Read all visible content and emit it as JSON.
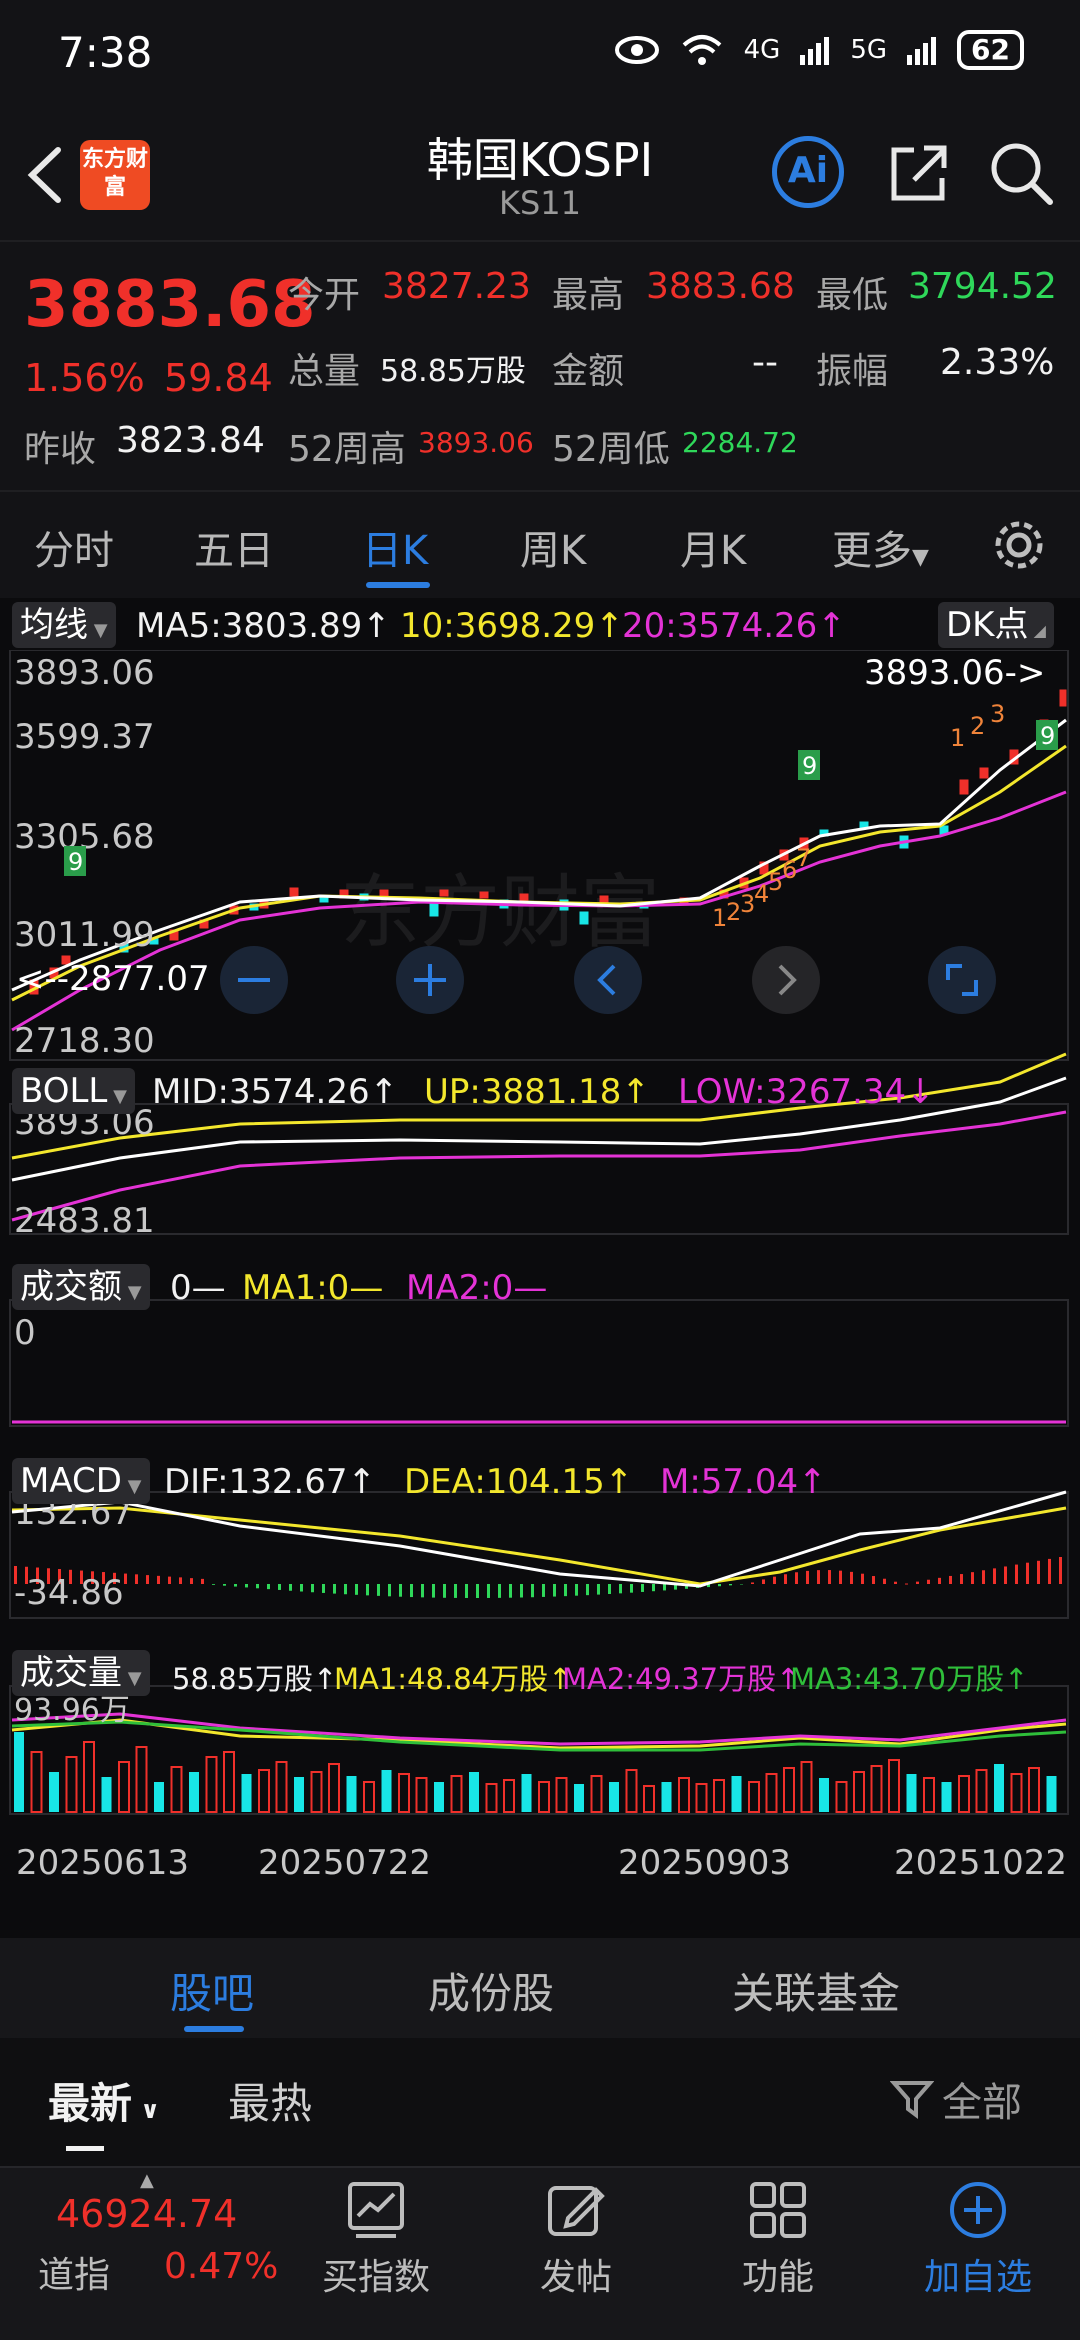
{
  "status": {
    "time": "7:38",
    "net1": "4G",
    "net2": "5G",
    "battery": "62"
  },
  "header": {
    "logo": "东方财富",
    "title": "韩国KOSPI",
    "code": "KS11",
    "ai": "Ai"
  },
  "quote": {
    "price": "3883.68",
    "pct": "1.56%",
    "chg": "59.84",
    "open_label": "今开",
    "open": "3827.23",
    "high_label": "最高",
    "high": "3883.68",
    "low_label": "最低",
    "low": "3794.52",
    "vol_label": "总量",
    "vol": "58.85万股",
    "amt_label": "金额",
    "amt": "--",
    "amp_label": "振幅",
    "amp": "2.33%",
    "prev_label": "昨收",
    "prev": "3823.84",
    "w52h_label": "52周高",
    "w52h": "3893.06",
    "w52l_label": "52周低",
    "w52l": "2284.72"
  },
  "tabs": [
    "分时",
    "五日",
    "日K",
    "周K",
    "月K",
    "更多"
  ],
  "main_chart": {
    "pill": "均线",
    "ma5": "MA5:3803.89↑",
    "ma10": "10:3698.29↑",
    "ma20": "20:3574.26↑",
    "dk": "DK点",
    "y_labels": [
      "3893.06",
      "3599.37",
      "3305.68",
      "3011.99",
      "2718.30"
    ],
    "max_label": "3893.06->",
    "min_label": "<--2877.07",
    "watermark": "东方财富",
    "td_upper": [
      "1",
      "2",
      "3"
    ],
    "td_nine": "9",
    "td_lower": [
      "1",
      "2",
      "3",
      "4",
      "5",
      "6",
      "7"
    ]
  },
  "boll": {
    "pill": "BOLL",
    "mid": "MID:3574.26↑",
    "up": "UP:3881.18↑",
    "low": "LOW:3267.34↓",
    "y_top": "3893.06",
    "y_bot": "2483.81"
  },
  "turnover": {
    "pill": "成交额",
    "val": "0—",
    "ma1": "MA1:0—",
    "ma2": "MA2:0—",
    "y": "0"
  },
  "macd": {
    "pill": "MACD",
    "dif": "DIF:132.67↑",
    "dea": "DEA:104.15↑",
    "m": "M:57.04↑",
    "y_top": "132.67",
    "y_bot": "-34.86"
  },
  "volume": {
    "pill": "成交量",
    "val": "58.85万股↑",
    "ma1": "MA1:48.84万股↑",
    "ma2": "MA2:49.37万股↑",
    "ma3": "MA3:43.70万股↑",
    "y": "93.96万"
  },
  "dates": [
    "20250613",
    "20250722",
    "20250903",
    "20251022"
  ],
  "community": {
    "tabs": [
      "股吧",
      "成份股",
      "关联基金"
    ]
  },
  "sort": {
    "latest": "最新",
    "hot": "最热",
    "filter": "全部"
  },
  "nav": {
    "index_value": "46924.74",
    "index_name": "道指",
    "index_pct": "0.47%",
    "items": [
      "买指数",
      "发帖",
      "功能",
      "加自选"
    ]
  },
  "colors": {
    "up": "#f0302a",
    "down": "#2fd85a",
    "accent": "#2c7de0",
    "ma5": "#ffffff",
    "ma10": "#f3e72d",
    "ma20": "#e433d6",
    "ma3": "#2fbf3a",
    "vol_down": "#18e6e6"
  }
}
